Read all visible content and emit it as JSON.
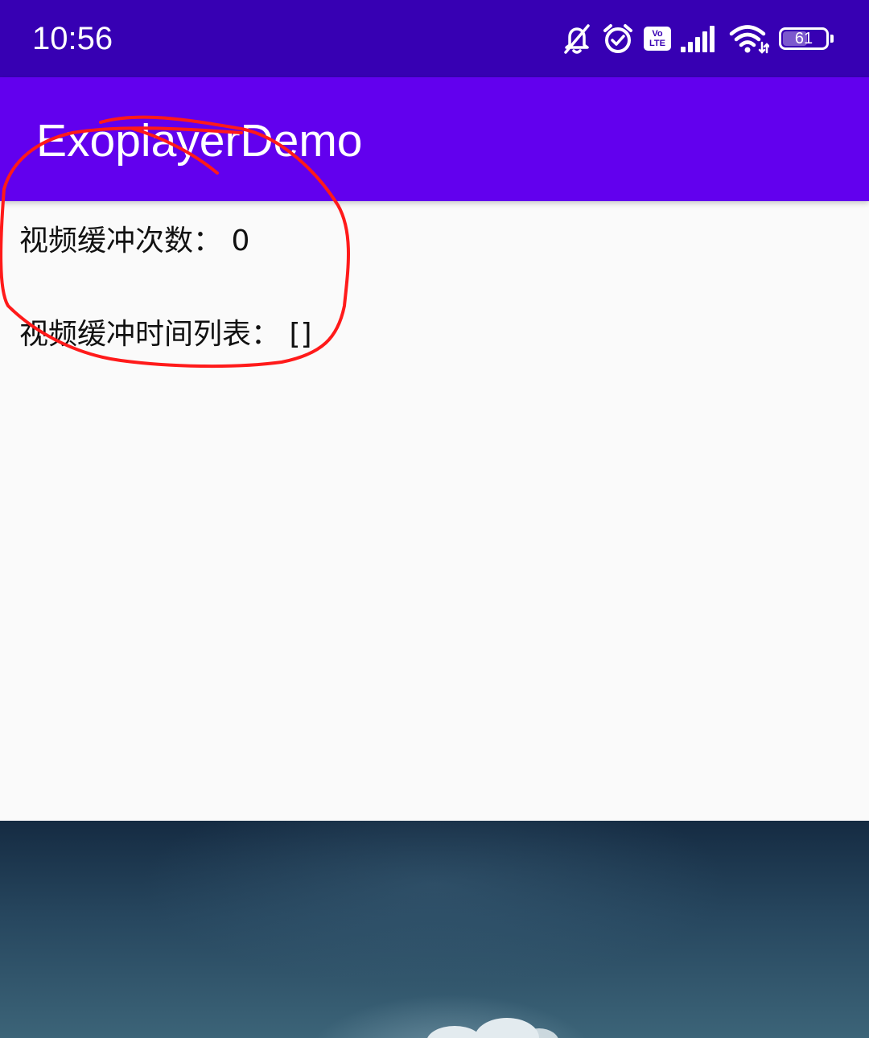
{
  "status_bar": {
    "time": "10:56",
    "volte_top": "Vo",
    "volte_bottom": "LTE",
    "battery_level": "61",
    "battery_fraction": 0.61,
    "icons": [
      "bell-off-icon",
      "alarm-clock-icon",
      "volte-icon",
      "signal-icon",
      "wifi-icon",
      "battery-icon"
    ]
  },
  "app_bar": {
    "title": "ExoplayerDemo"
  },
  "content": {
    "buffer_count_line": "视频缓冲次数：  0",
    "buffer_times_line": "视频缓冲时间列表：  []"
  },
  "colors": {
    "status_bar": "#3700b3",
    "app_bar": "#6200ee",
    "background": "#fafafa",
    "annotation": "#ff1a1a"
  }
}
